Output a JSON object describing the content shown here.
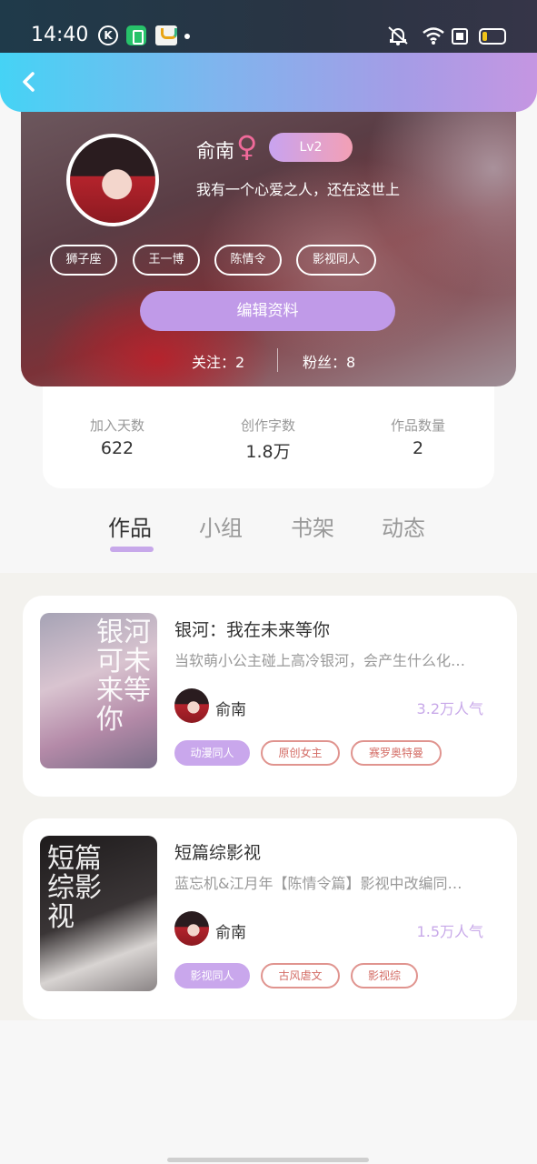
{
  "status_bar": {
    "time": "14:40"
  },
  "profile": {
    "nickname": "俞南",
    "gender_icon": "female-symbol",
    "level": "Lv2",
    "signature": "我有一个心爱之人，还在这世上",
    "tags": [
      "狮子座",
      "王一博",
      "陈情令",
      "影视同人"
    ],
    "edit_button": "编辑资料",
    "following_text": "关注：2",
    "followers_text": "粉丝：8"
  },
  "stats": [
    {
      "label": "加入天数",
      "value": "622"
    },
    {
      "label": "创作字数",
      "value": "1.8万"
    },
    {
      "label": "作品数量",
      "value": "2"
    }
  ],
  "tabs": [
    {
      "label": "作品",
      "active": true
    },
    {
      "label": "小组",
      "active": false
    },
    {
      "label": "书架",
      "active": false
    },
    {
      "label": "动态",
      "active": false
    }
  ],
  "works": [
    {
      "cover_text": "银河可未来等你",
      "title": "银河：我在未来等你",
      "description": "当软萌小公主碰上高冷银河，会产生什么化…",
      "author": "俞南",
      "popularity": "3.2万人气",
      "tags": [
        "动漫同人",
        "原创女主",
        "赛罗奥特曼"
      ]
    },
    {
      "cover_text": "短篇综影视",
      "title": "短篇综影视",
      "description": "蓝忘机&江月年【陈情令篇】影视中改编同…",
      "author": "俞南",
      "popularity": "1.5万人气",
      "tags": [
        "影视同人",
        "古风虐文",
        "影视综"
      ]
    }
  ],
  "colors": {
    "accent": "#c09ae8",
    "header_gradient_start": "#45d3f5",
    "header_gradient_end": "#c596e2",
    "tag_outline": "#e0948f"
  }
}
